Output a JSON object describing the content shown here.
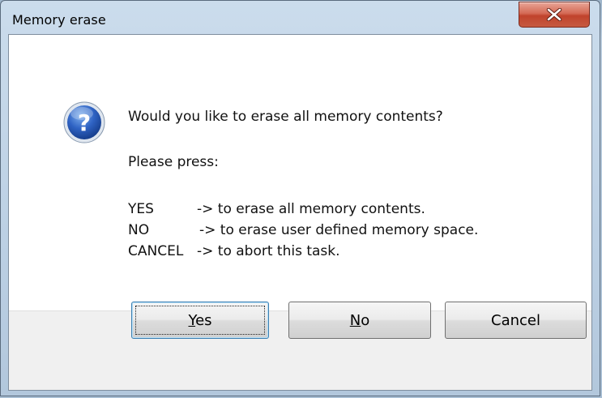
{
  "window": {
    "title": "Memory erase",
    "close_label": "X"
  },
  "message": {
    "question": "Would you like to erase all memory contents?",
    "instruction": "Please press:",
    "options": [
      {
        "key": "YES",
        "desc": "-> to erase all memory contents."
      },
      {
        "key": "NO",
        "desc": "-> to erase user defined memory space."
      },
      {
        "key": "CANCEL",
        "desc": "-> to abort this task."
      }
    ]
  },
  "buttons": {
    "yes_mnemonic": "Y",
    "yes_rest": "es",
    "no_mnemonic": "N",
    "no_rest": "o",
    "cancel": "Cancel"
  },
  "icon": "question-icon",
  "colors": {
    "close_button": "#c8462f",
    "icon_blue": "#1f4fa8",
    "dialog_bg": "#ffffff",
    "footer_bg": "#f0f0f0"
  }
}
